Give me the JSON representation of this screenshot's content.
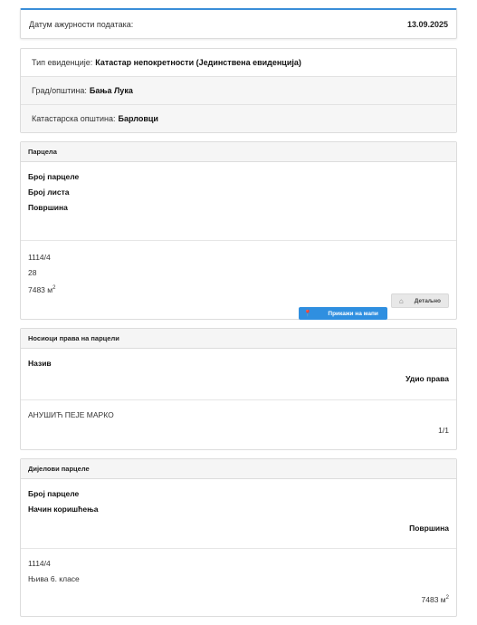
{
  "date_panel": {
    "label": "Датум ажурности података:",
    "value": "13.09.2025"
  },
  "info": {
    "evidence_label": "Тип евиденције:",
    "evidence_value": "Катастар непокретности (Јединствена евиденција)",
    "city_label": "Град/општина:",
    "city_value": "Бања Лука",
    "municipality_label": "Катастарска општина:",
    "municipality_value": "Барловци"
  },
  "parcel": {
    "title": "Парцела",
    "headers": [
      "Број парцеле",
      "Број листа",
      "Површина"
    ],
    "number": "1114/4",
    "sheet": "28",
    "area": "7483 м",
    "area_sup": "2",
    "map_button": "Прикажи на мапи",
    "detail_button": "Детаљно",
    "map_icon": "map-pin-icon",
    "detail_icon": "home-icon"
  },
  "owners": {
    "title": "Носиоци права на парцели",
    "header_name": "Назив",
    "header_share": "Удио права",
    "name": "АНУШИЋ ПЕЈЕ МАРКО",
    "share": "1/1"
  },
  "parts": {
    "title": "Дијелови парцеле",
    "header_number": "Број парцеле",
    "header_use": "Начин коришћења",
    "header_area": "Површина",
    "number": "1114/4",
    "use": "Њива 6. класе",
    "area": "7483 м",
    "area_sup": "2"
  },
  "colors": {
    "accent": "#2f8fe0",
    "panel_border": "#dcdcdc"
  }
}
